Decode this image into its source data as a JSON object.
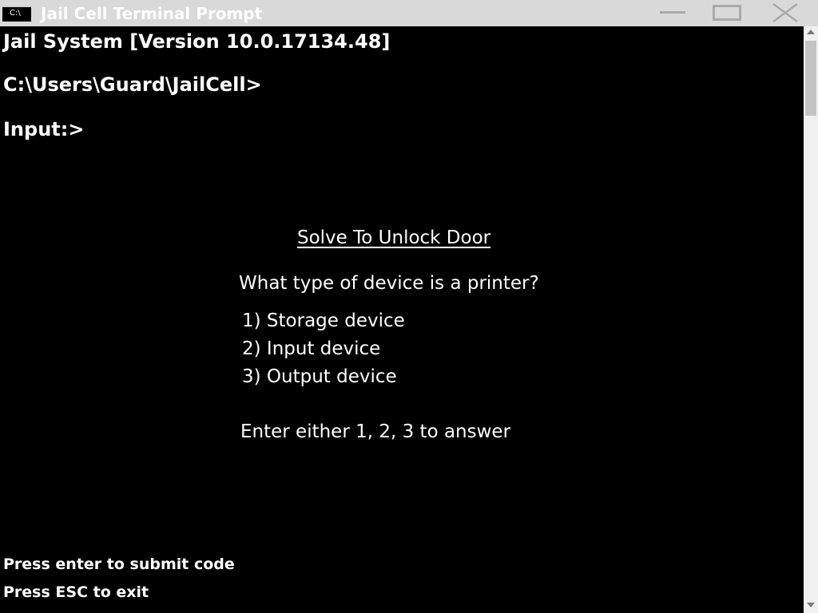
{
  "window": {
    "title": "Jail Cell Terminal Prompt",
    "icon_label": "C:\\"
  },
  "console": {
    "version_line": "Jail System [Version 10.0.17134.48]",
    "path_line": "C:\\Users\\Guard\\JailCell>",
    "input_line": "Input:>"
  },
  "puzzle": {
    "title": "Solve To Unlock Door",
    "question": "What type of device is a printer?",
    "options": [
      "1) Storage device",
      "2) Input device",
      "3) Output device"
    ],
    "instruction": "Enter either 1, 2, 3 to answer"
  },
  "footer": {
    "submit_hint": "Press enter to submit code",
    "exit_hint": "Press ESC to exit"
  },
  "colors": {
    "titlebar_bg": "#d9d9d9",
    "console_bg": "#000000",
    "text": "#ffffff",
    "scrollbar_bg": "#f0f0f0"
  }
}
